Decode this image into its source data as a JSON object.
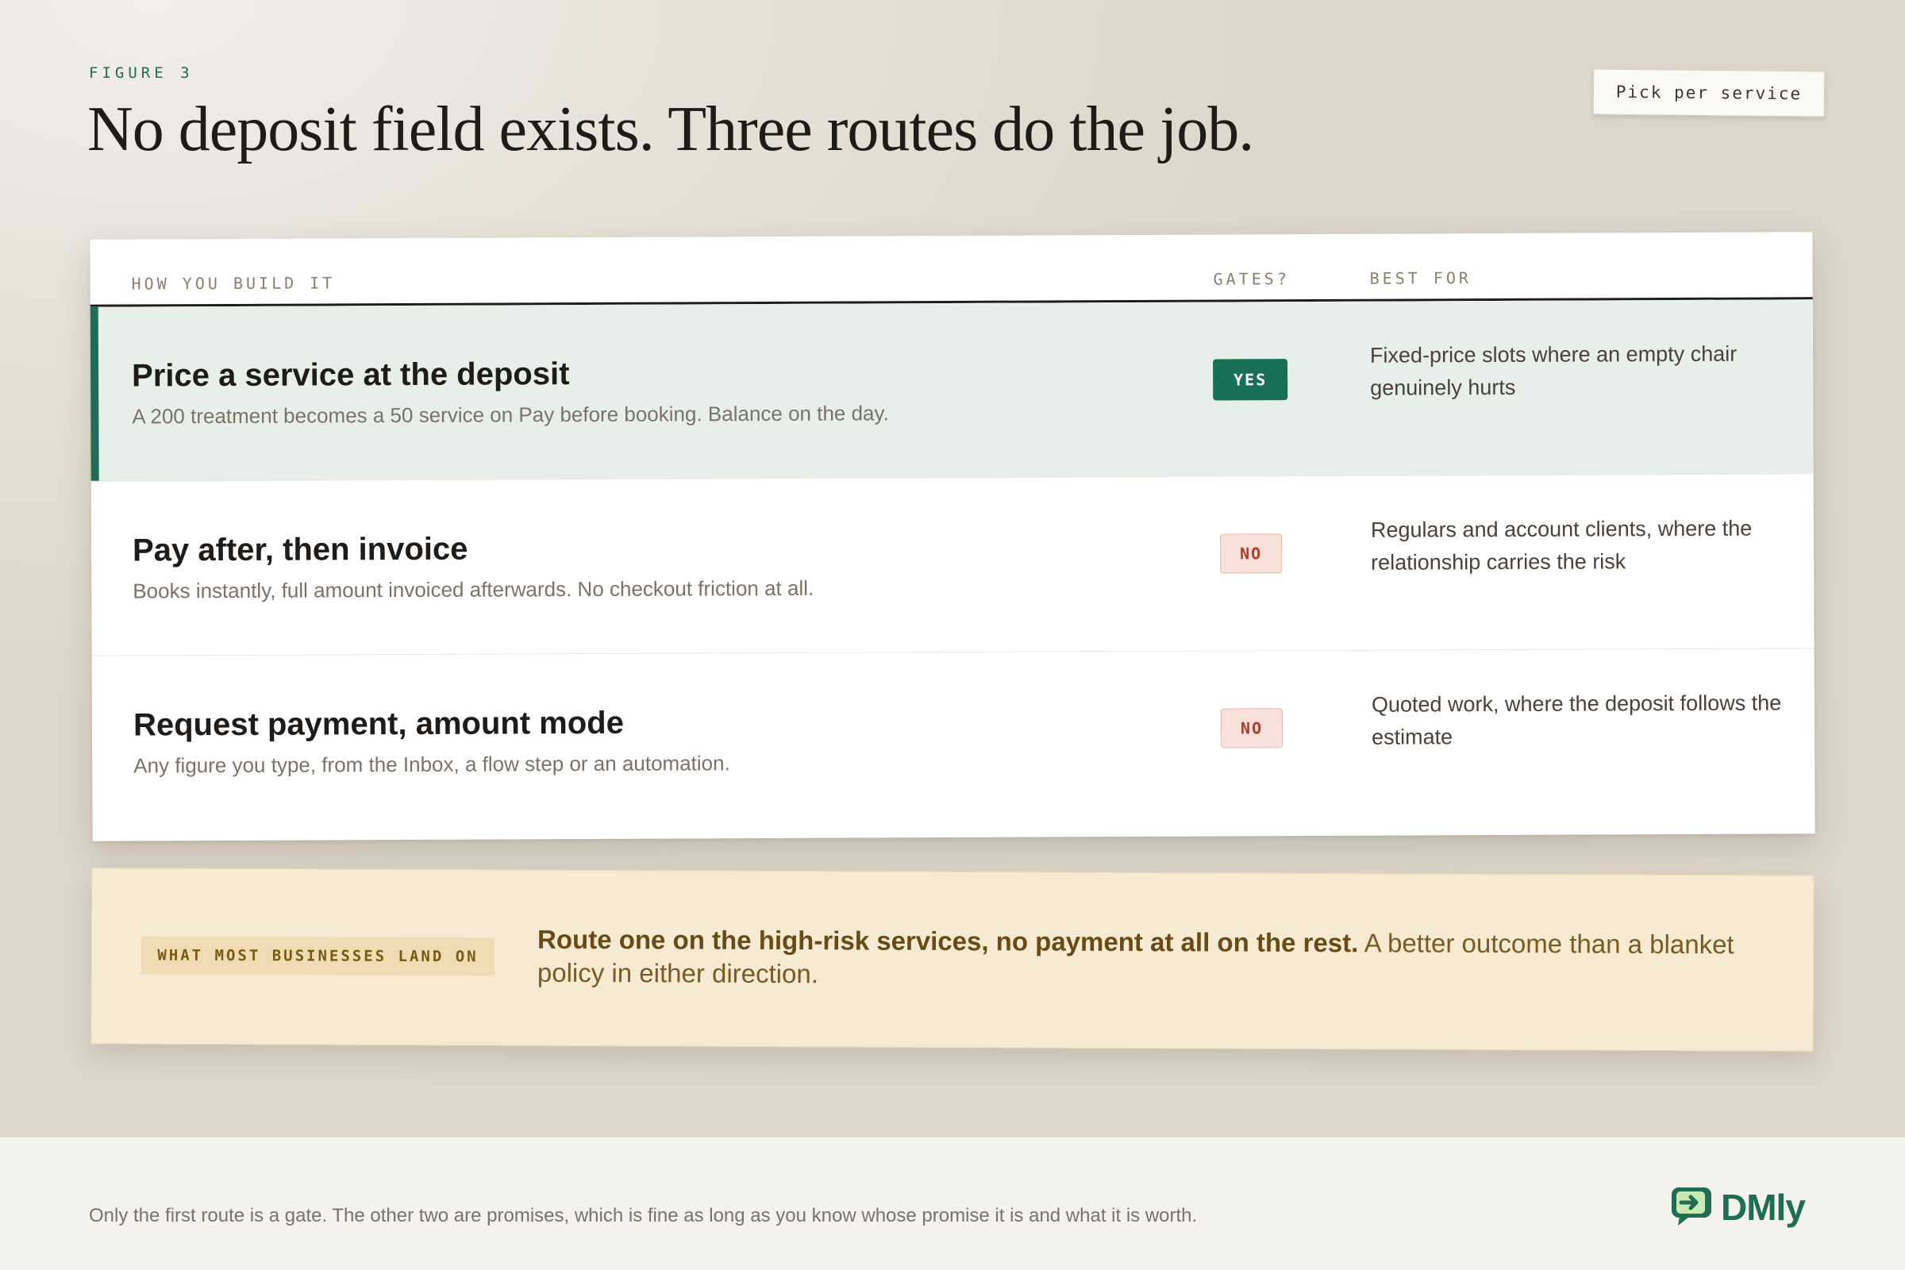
{
  "figure_label": "FIGURE 3",
  "title": "No deposit field exists. Three routes do the job.",
  "sticker": "Pick per service",
  "table": {
    "columns": [
      "HOW YOU BUILD IT",
      "GATES?",
      "BEST FOR"
    ],
    "rows": [
      {
        "title": "Price a service at the deposit",
        "subtitle": "A 200 treatment becomes a 50 service on Pay before booking. Balance on the day.",
        "gates": "YES",
        "best_for": "Fixed-price slots where an empty chair genuinely hurts"
      },
      {
        "title": "Pay after, then invoice",
        "subtitle": "Books instantly, full amount invoiced afterwards. No checkout friction at all.",
        "gates": "NO",
        "best_for": "Regulars and account clients, where the relationship carries the risk"
      },
      {
        "title": "Request payment, amount mode",
        "subtitle": "Any figure you type, from the Inbox, a flow step or an automation.",
        "gates": "NO",
        "best_for": "Quoted work, where the deposit follows the estimate"
      }
    ]
  },
  "callout": {
    "tag": "WHAT MOST BUSINESSES LAND ON",
    "bold": "Route one on the high-risk services, no payment at all on the rest.",
    "rest": " A better outcome than a blanket policy in either direction."
  },
  "footer": {
    "note": "Only the first route is a gate. The other two are promises, which is fine as long as you know whose promise it is and what it is worth.",
    "logo": "DMly"
  },
  "colors": {
    "accent_green": "#1d6e55",
    "highlight_row": "#e6efe9",
    "no_badge": "#f8e1da",
    "callout_bg": "#f6ead3"
  },
  "icons": [
    "chat-arrow-logo-icon"
  ]
}
